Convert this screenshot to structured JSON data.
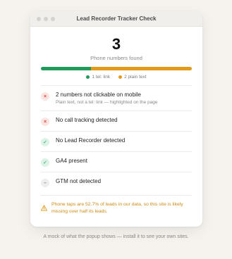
{
  "window": {
    "title": "Lead Recorder Tracker Check"
  },
  "summary": {
    "count": "3",
    "label": "Phone numbers found"
  },
  "bar": {
    "tel_fraction": 0.3333,
    "plain_fraction": 0.6667
  },
  "colors": {
    "tel": "#1f9a5b",
    "plain": "#e39a17",
    "fail": "#d9443a",
    "pass": "#1f9a5b",
    "warning": "#d08a12"
  },
  "legend": {
    "tel": "1 tel: link",
    "plain": "2 plain text"
  },
  "checks": [
    {
      "status": "fail",
      "icon": "×",
      "title": "2 numbers not clickable on mobile",
      "subtitle": "Plain text, not a tel: link — highlighted on the page"
    },
    {
      "status": "fail",
      "icon": "×",
      "title": "No call tracking detected",
      "subtitle": ""
    },
    {
      "status": "pass",
      "icon": "✓",
      "title": "No Lead Recorder detected",
      "subtitle": ""
    },
    {
      "status": "pass",
      "icon": "✓",
      "title": "GA4 present",
      "subtitle": ""
    },
    {
      "status": "neutral",
      "icon": "–",
      "title": "GTM not detected",
      "subtitle": ""
    }
  ],
  "warning": {
    "icon": "warning-triangle-icon",
    "text": "Phone taps are 52.7% of leads in our data, so this site is likely missing over half its leads."
  },
  "caption": "A mock of what the popup shows — install it to see your own sites."
}
